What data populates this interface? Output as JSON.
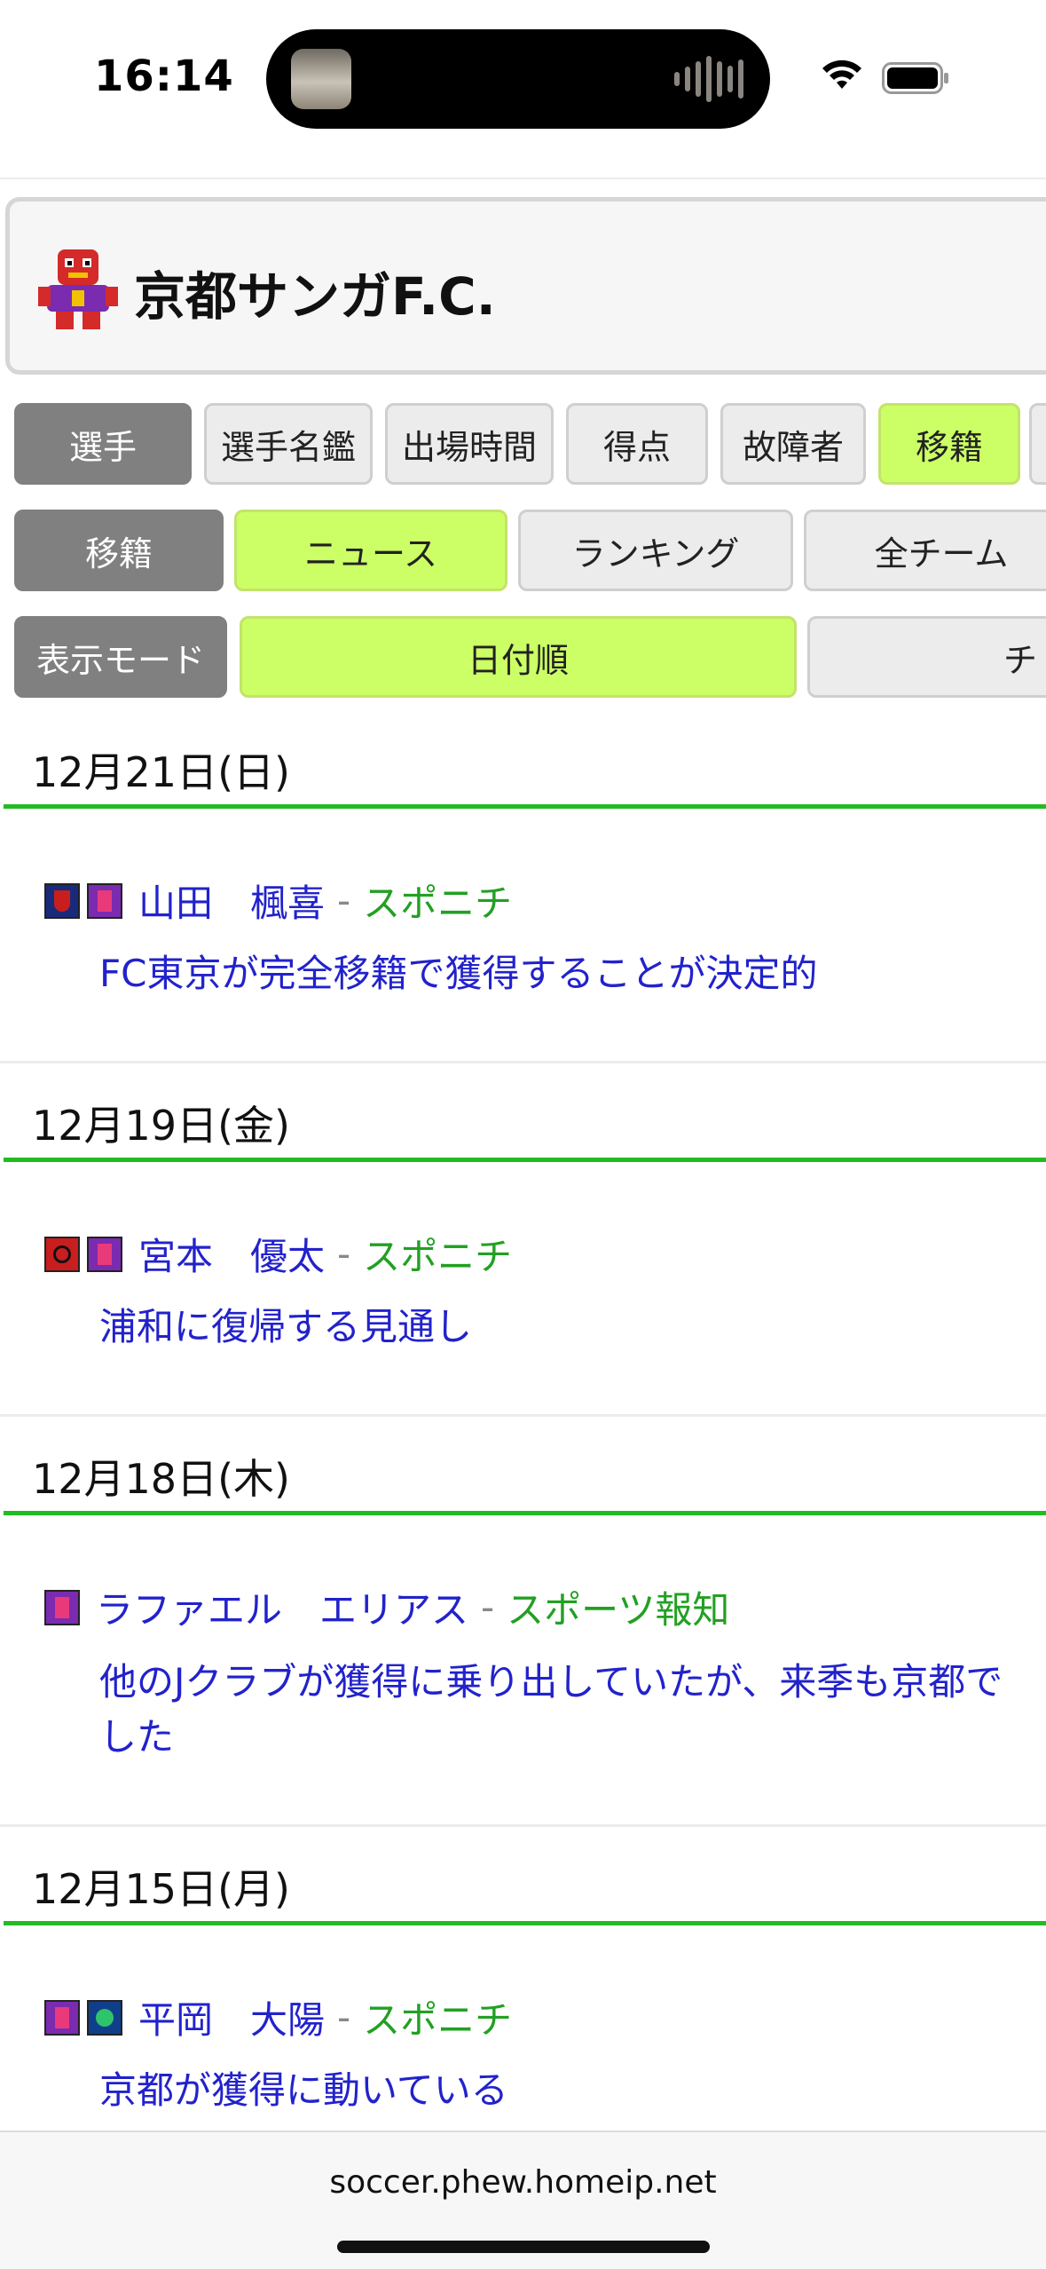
{
  "status": {
    "time": "16:14"
  },
  "team": {
    "name": "京都サンガF.C."
  },
  "nav_row1": {
    "label": "選手",
    "items": [
      "選手名鑑",
      "出場時間",
      "得点",
      "故障者",
      "移籍"
    ]
  },
  "nav_row2": {
    "label": "移籍",
    "items": [
      "ニュース",
      "ランキング",
      "全チーム"
    ]
  },
  "nav_row3": {
    "label": "表示モード",
    "items": [
      "日付順",
      "チ"
    ]
  },
  "news": [
    {
      "date": "12月21日(日)",
      "player": "山田　楓喜",
      "source": "スポニチ",
      "lines": [
        "FC東京が完全移籍で獲得することが決定的"
      ]
    },
    {
      "date": "12月19日(金)",
      "player": "宮本　優太",
      "source": "スポニチ",
      "lines": [
        "浦和に復帰する見通し"
      ]
    },
    {
      "date": "12月18日(木)",
      "player": "ラファエル　エリアス",
      "source": "スポーツ報知",
      "lines": [
        "他のJクラブが獲得に乗り出していたが、来季も京都で",
        "した"
      ]
    },
    {
      "date": "12月15日(月)",
      "player": "平岡　大陽",
      "source": "スポニチ",
      "lines": [
        "京都が獲得に動いている"
      ]
    }
  ],
  "footer": {
    "url": "soccer.phew.homeip.net"
  },
  "colors": {
    "active": "#ccff66",
    "link": "#2222cc",
    "source": "#22a022",
    "divider": "#22bb22"
  }
}
